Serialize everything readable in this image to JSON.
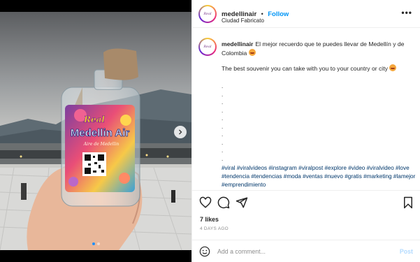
{
  "post": {
    "username": "medellinair",
    "separator": "•",
    "follow_label": "Follow",
    "location": "Ciudad Fabricato",
    "more_icon": "more-horizontal-icon",
    "avatar_text": "Real"
  },
  "photo": {
    "bottle_label_top": "Real",
    "bottle_label_main": "Medellin Air",
    "bottle_label_sub": "Aire de Medellin",
    "carousel_dot_count": 2,
    "carousel_active_index": 0
  },
  "caption": {
    "line1": "El mejor recuerdo que te puedes llevar de Medellín y de Colombia",
    "line2": "The best souvenir you can take with you to your country or city",
    "dots": [
      ".",
      ".",
      ".",
      ".",
      ".",
      ".",
      ".",
      ".",
      ".",
      "."
    ],
    "hashtags": [
      "#viral",
      "#viralvideos",
      "#instagram",
      "#viralpost",
      "#explore",
      "#video",
      "#viralvideo",
      "#love",
      "#tendencia",
      "#tendencias",
      "#moda",
      "#ventas",
      "#nuevo",
      "#gratis",
      "#marketing",
      "#lamejor",
      "#emprendimiento"
    ]
  },
  "stats": {
    "likes": "7 likes",
    "time": "4 DAYS AGO"
  },
  "comment": {
    "placeholder": "Add a comment...",
    "post_label": "Post"
  },
  "colors": {
    "follow": "#0095f6",
    "hashtag": "#00376b",
    "post_disabled": "#b3dbff",
    "carousel_active": "#1e90ff"
  }
}
